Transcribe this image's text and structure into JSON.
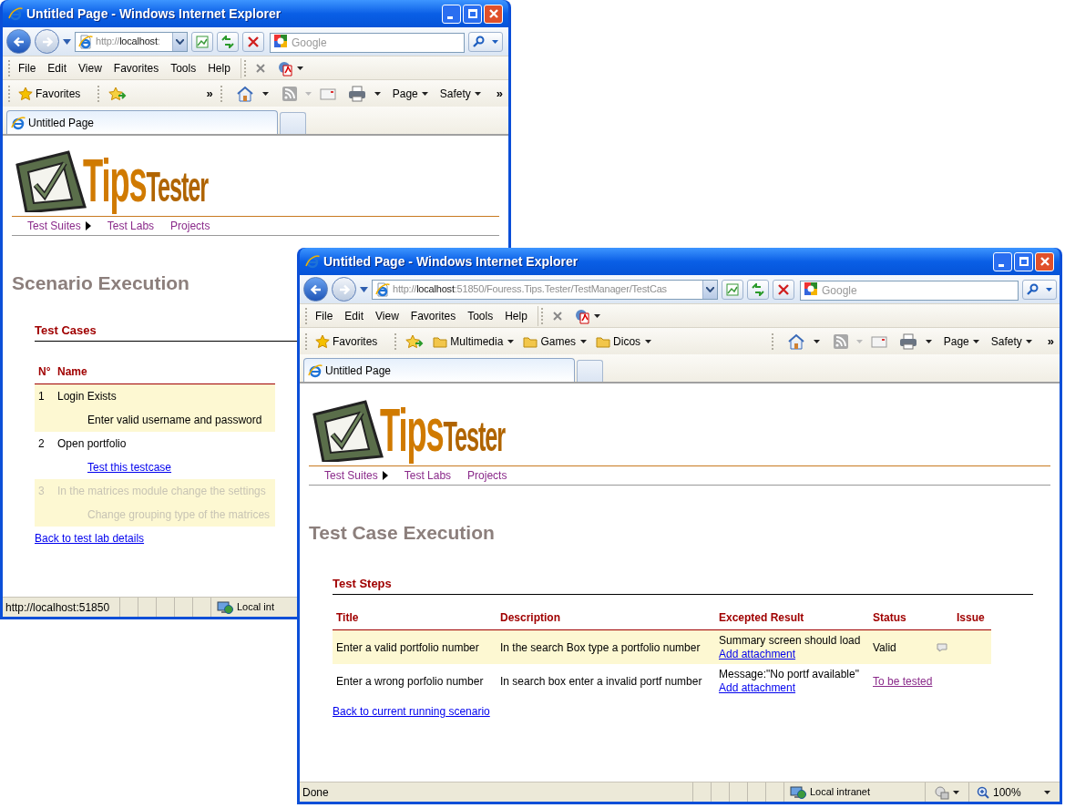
{
  "windows": [
    {
      "title": "Untitled Page - Windows Internet Explorer",
      "address_parts": [
        "http://",
        "localhost",
        ":"
      ],
      "search_placeholder": "Google",
      "menu": [
        "File",
        "Edit",
        "View",
        "Favorites",
        "Tools",
        "Help"
      ],
      "favorites_label": "Favorites",
      "favorites_overflow": "»",
      "commands": [
        "Page",
        "Safety"
      ],
      "commands_overflow": "»",
      "tab": {
        "label": "Untitled Page",
        "selected": true
      },
      "page": {
        "kind": "scenario",
        "logo": [
          "Tips",
          "Tester"
        ],
        "nav": [
          {
            "label": "Test Suites",
            "submenu": true
          },
          {
            "label": "Test Labs",
            "submenu": false
          },
          {
            "label": "Projects",
            "submenu": false
          }
        ],
        "heading": "Scenario Execution",
        "section": "Test Cases",
        "columns": [
          "N°",
          "Name"
        ],
        "rows": [
          {
            "number": "1",
            "name": "Login Exists",
            "detail": {
              "kind": "text",
              "text": "Enter valid username and password"
            },
            "highlighted": true,
            "disabled": false
          },
          {
            "number": "2",
            "name": "Open portfolio",
            "detail": {
              "kind": "link",
              "text": "Test this testcase"
            },
            "highlighted": false,
            "disabled": false
          },
          {
            "number": "3",
            "name": "In the matrices module change the settings",
            "detail": {
              "kind": "text",
              "text": "Change grouping type of the matrices"
            },
            "highlighted": true,
            "disabled": true
          }
        ],
        "back_link": "Back to test lab details"
      },
      "status": {
        "text": "http://localhost:51850",
        "zone": "Local int"
      }
    },
    {
      "title": "Untitled Page - Windows Internet Explorer",
      "address_parts": [
        "http://",
        "localhost",
        ":51850/Fouress.Tips.Tester/TestManager/TestCas"
      ],
      "search_placeholder": "Google",
      "menu": [
        "File",
        "Edit",
        "View",
        "Favorites",
        "Tools",
        "Help"
      ],
      "favorites_label": "Favorites",
      "favorites_links": [
        "Multimedia",
        "Games",
        "Dicos"
      ],
      "commands": [
        "Page",
        "Safety"
      ],
      "commands_overflow": "»",
      "tab": {
        "label": "Untitled Page",
        "selected": true
      },
      "page": {
        "kind": "test_case",
        "logo": [
          "Tips",
          "Tester"
        ],
        "nav": [
          {
            "label": "Test Suites",
            "submenu": true
          },
          {
            "label": "Test Labs",
            "submenu": false
          },
          {
            "label": "Projects",
            "submenu": false
          }
        ],
        "heading": "Test Case Execution",
        "section": "Test Steps",
        "columns": [
          "Title",
          "Description",
          "Excepted Result",
          "Status",
          "Issue"
        ],
        "rows": [
          {
            "title": "Enter a valid portfolio number",
            "description": "In the search Box type a portfolio number",
            "expected": "Summary screen should load",
            "attachment": "Add attachment",
            "status": {
              "kind": "text",
              "text": "Valid"
            },
            "highlighted": true,
            "has_comment": true
          },
          {
            "title": "Enter a wrong porfolio number",
            "description": "In search box enter a invalid portf number",
            "expected": "Message:\"No portf available\"",
            "attachment": "Add attachment",
            "status": {
              "kind": "link",
              "text": "To be tested"
            },
            "highlighted": false,
            "has_comment": false
          }
        ],
        "back_link": "Back to current running scenario"
      },
      "status": {
        "text": "Done",
        "zone": "Local intranet",
        "zoom": "100%"
      }
    }
  ]
}
